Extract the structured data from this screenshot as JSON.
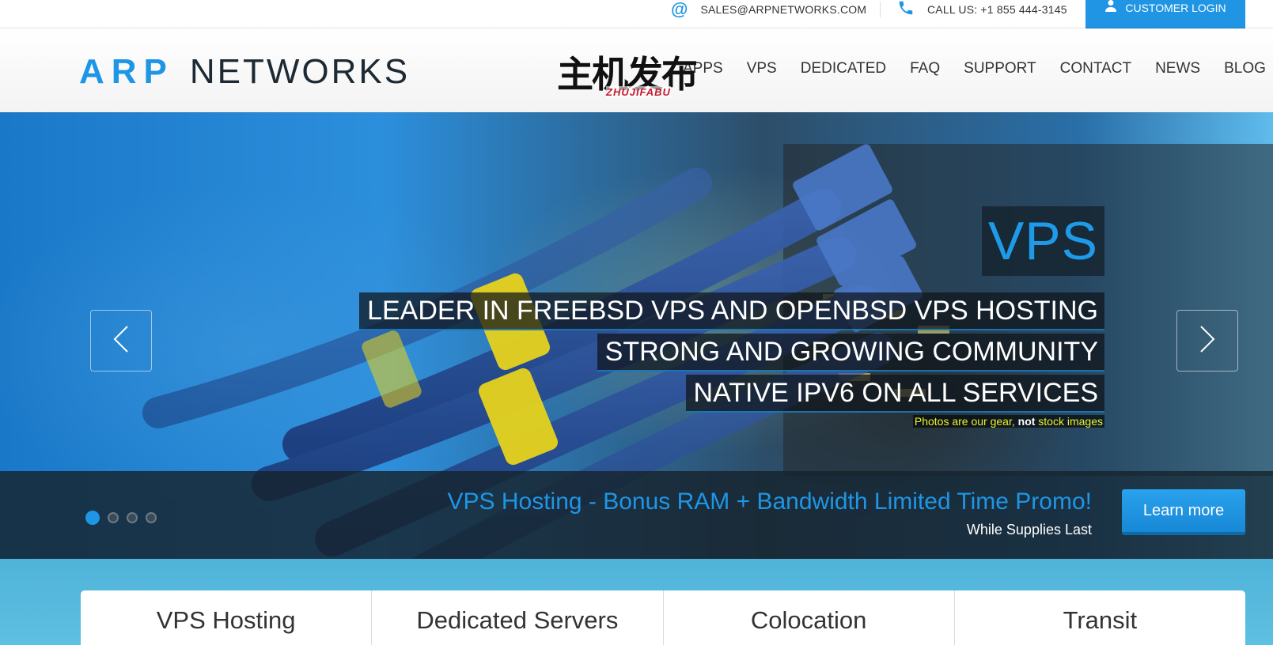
{
  "topbar": {
    "email_icon": "at-icon",
    "email": "SALES@ARPNETWORKS.COM",
    "phone_icon": "phone-icon",
    "phone": "CALL US: +1 855 444-3145",
    "login_icon": "user-icon",
    "login_label": "CUSTOMER LOGIN"
  },
  "header": {
    "logo_part1": "ARP",
    "logo_part2": "NETWORKS",
    "nav": [
      "APPS",
      "VPS",
      "DEDICATED",
      "FAQ",
      "SUPPORT",
      "CONTACT",
      "NEWS",
      "BLOG"
    ]
  },
  "watermark": {
    "cn": "主机发布",
    "en": "ZHUJIFABU"
  },
  "slider": {
    "title": "VPS",
    "lines": [
      "LEADER IN FREEBSD VPS AND OPENBSD VPS HOSTING",
      "STRONG AND GROWING COMMUNITY",
      "NATIVE IPV6 ON ALL SERVICES"
    ],
    "note_before": "Photos are our gear, ",
    "note_bold": "not",
    "note_after": " stock images",
    "prev_icon": "chevron-left-icon",
    "next_icon": "chevron-right-icon",
    "dot_count": 4,
    "active_dot": 1
  },
  "promo": {
    "title": "VPS Hosting - Bonus RAM + Bandwidth Limited Time Promo!",
    "subtitle": "While Supplies Last",
    "button": "Learn more"
  },
  "services": [
    "VPS Hosting",
    "Dedicated Servers",
    "Colocation",
    "Transit"
  ],
  "colors": {
    "accent": "#1e96e5",
    "note_yellow": "#eaf22a",
    "services_band": "#56b9dd"
  }
}
